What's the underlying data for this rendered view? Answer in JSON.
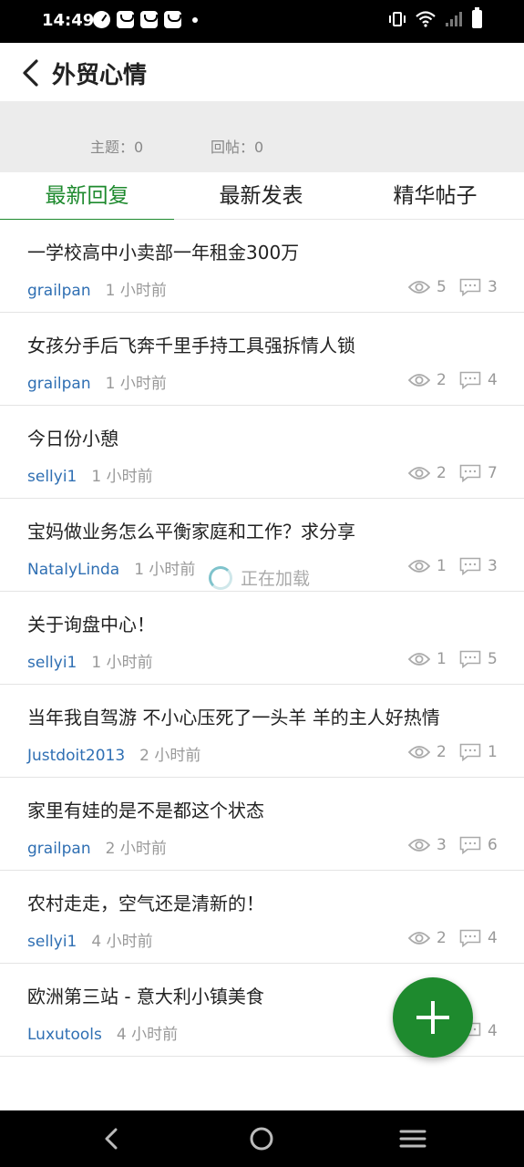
{
  "status_bar": {
    "time": "14:49",
    "icons": [
      "speedometer-icon",
      "notification-icon",
      "notification-icon",
      "notification-icon",
      "dot-icon",
      "vibrate-icon",
      "wifi-icon",
      "signal-icon",
      "battery-icon"
    ]
  },
  "header": {
    "back_icon": "chevron-left-icon",
    "title": "外贸心情"
  },
  "stats": {
    "topics": "主题：0",
    "replies": "回帖：0"
  },
  "tabs": [
    {
      "label": "最新回复",
      "active": true
    },
    {
      "label": "最新发表",
      "active": false
    },
    {
      "label": "精华帖子",
      "active": false
    }
  ],
  "posts": [
    {
      "title": "一学校高中小卖部一年租金300万",
      "author": "grailpan",
      "time": "1 小时前",
      "views": "5",
      "replies": "3"
    },
    {
      "title": "女孩分手后飞奔千里手持工具强拆情人锁",
      "author": "grailpan",
      "time": "1 小时前",
      "views": "2",
      "replies": "4"
    },
    {
      "title": "今日份小憩",
      "author": "sellyi1",
      "time": "1 小时前",
      "views": "2",
      "replies": "7"
    },
    {
      "title": "宝妈做业务怎么平衡家庭和工作？求分享",
      "author": "NatalyLinda",
      "time": "1 小时前",
      "views": "1",
      "replies": "3"
    },
    {
      "title": "关于询盘中心！",
      "author": "sellyi1",
      "time": "1 小时前",
      "views": "1",
      "replies": "5"
    },
    {
      "title": "当年我自驾游 不小心压死了一头羊 羊的主人好热情",
      "author": "Justdoit2013",
      "time": "2 小时前",
      "views": "2",
      "replies": "1"
    },
    {
      "title": "家里有娃的是不是都这个状态",
      "author": "grailpan",
      "time": "2 小时前",
      "views": "3",
      "replies": "6"
    },
    {
      "title": "农村走走，空气还是清新的！",
      "author": "sellyi1",
      "time": "4 小时前",
      "views": "2",
      "replies": "4"
    },
    {
      "title": "欧洲第三站 - 意大利小镇美食",
      "author": "Luxutools",
      "time": "4 小时前",
      "views": "",
      "replies": "4"
    }
  ],
  "loading": {
    "text": "正在加载"
  },
  "fab": {
    "icon": "plus-icon",
    "color": "#1e8a2e"
  },
  "colors": {
    "accent": "#1e8a2e",
    "author_link": "#2f6fb3"
  },
  "nav_bar": {
    "icons": [
      "back-nav-icon",
      "home-nav-icon",
      "recents-nav-icon"
    ]
  }
}
